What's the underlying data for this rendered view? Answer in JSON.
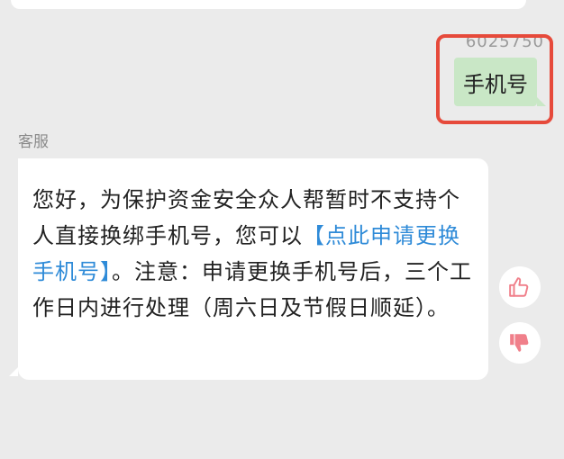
{
  "conversation": {
    "user_id": "6025750",
    "user_message": "手机号",
    "agent_label": "客服",
    "agent_message": {
      "text_before": "您好，为保护资金安全众人帮暂时不支持个人直接换绑手机号，您可以",
      "link_text": "【点此申请更换手机号】",
      "text_after": "。注意：申请更换手机号后，三个工作日内进行处理（周六日及节假日顺延）。"
    }
  },
  "feedback": {
    "thumbs_up_icon": "thumbs-up-icon",
    "thumbs_down_icon": "thumbs-down-icon",
    "icon_color": "#f07f8a"
  },
  "colors": {
    "user_bubble": "#c9e7c6",
    "link": "#2f8bd8",
    "highlight": "#e64a3b"
  }
}
